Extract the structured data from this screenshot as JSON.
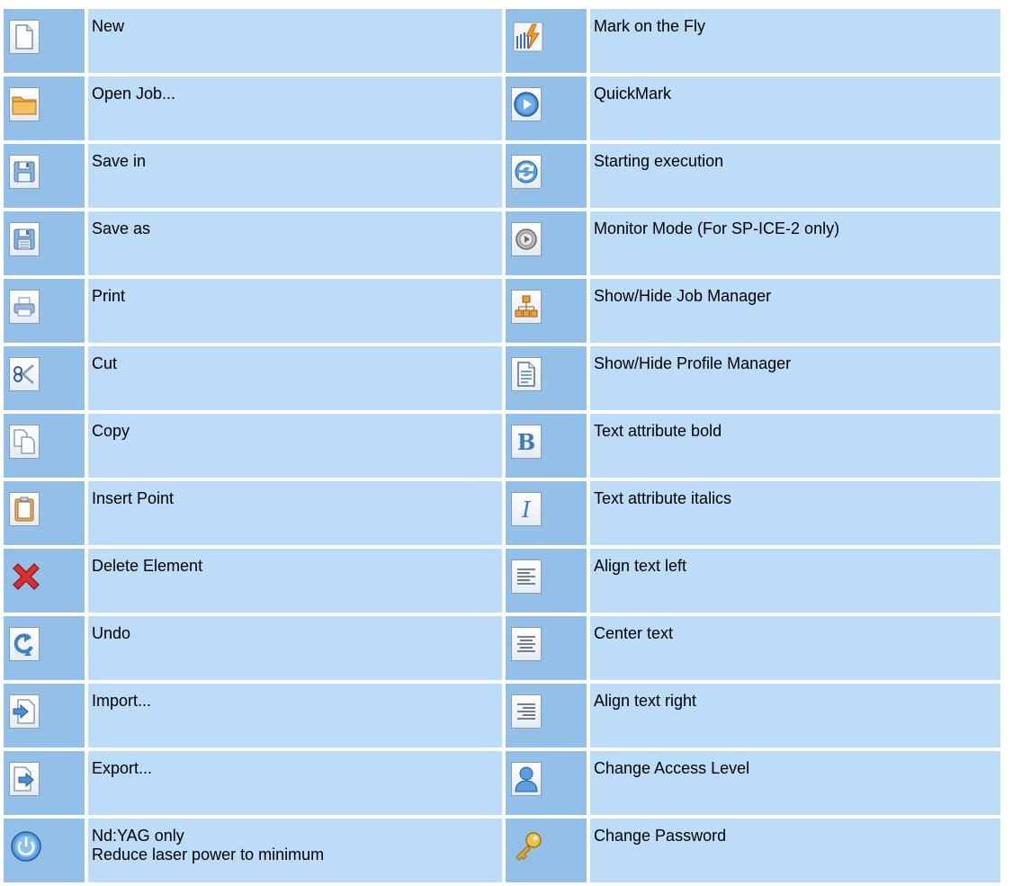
{
  "left_column": [
    {
      "icon": "new-document-icon",
      "label": "New"
    },
    {
      "icon": "open-folder-icon",
      "label": "Open Job..."
    },
    {
      "icon": "save-floppy-icon",
      "label": "Save in"
    },
    {
      "icon": "save-as-floppy-icon",
      "label": "Save as"
    },
    {
      "icon": "printer-icon",
      "label": "Print"
    },
    {
      "icon": "scissors-icon",
      "label": "Cut"
    },
    {
      "icon": "copy-icon",
      "label": "Copy"
    },
    {
      "icon": "clipboard-icon",
      "label": "Insert Point"
    },
    {
      "icon": "red-x-icon",
      "label": "Delete Element"
    },
    {
      "icon": "undo-icon",
      "label": "Undo"
    },
    {
      "icon": "import-icon",
      "label": "Import..."
    },
    {
      "icon": "export-icon",
      "label": "Export..."
    },
    {
      "icon": "power-icon",
      "label": "Nd:YAG only",
      "label2": "Reduce laser power to minimum"
    }
  ],
  "right_column": [
    {
      "icon": "lightning-barcode-icon",
      "label": "Mark on the Fly"
    },
    {
      "icon": "play-circle-icon",
      "label": "QuickMark"
    },
    {
      "icon": "refresh-execution-icon",
      "label": "Starting execution"
    },
    {
      "icon": "monitor-mode-icon",
      "label": "Monitor Mode (For SP-ICE-2 only)"
    },
    {
      "icon": "org-chart-icon",
      "label": "Show/Hide Job Manager"
    },
    {
      "icon": "profile-document-icon",
      "label": "Show/Hide Profile Manager"
    },
    {
      "icon": "bold-icon",
      "label": "Text attribute bold"
    },
    {
      "icon": "italic-icon",
      "label": "Text attribute italics"
    },
    {
      "icon": "align-left-icon",
      "label": "Align text left"
    },
    {
      "icon": "align-center-icon",
      "label": "Center text"
    },
    {
      "icon": "align-right-icon",
      "label": "Align text right"
    },
    {
      "icon": "user-icon",
      "label": "Change Access Level"
    },
    {
      "icon": "key-icon",
      "label": "Change Password"
    }
  ],
  "colors": {
    "icon_cell": "#93c0e8",
    "text_cell": "#bcdcf8",
    "accent_blue": "#3a7cc8",
    "delete_red": "#d03030",
    "folder_orange": "#e89a30",
    "key_gold": "#e0b030"
  }
}
